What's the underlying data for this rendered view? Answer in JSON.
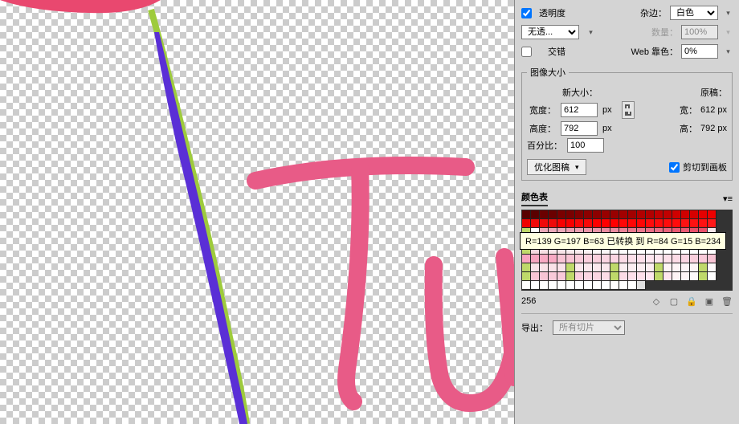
{
  "options": {
    "transparency_label": "透明度",
    "transparency_checked": true,
    "matte_label": "杂边：",
    "matte_value": "白色",
    "no_transparency_value": "无透...",
    "amount_label": "数量：",
    "amount_value": "100%",
    "interlace_label": "交错",
    "interlace_checked": false,
    "web_snap_label": "Web 靠色：",
    "web_snap_value": "0%"
  },
  "image_size": {
    "legend": "图像大小",
    "new_size_label": "新大小：",
    "original_label": "原稿：",
    "width_label": "宽度：",
    "width_value": "612",
    "width_unit": "px",
    "original_width_label": "宽：",
    "original_width_value": "612  px",
    "height_label": "高度：",
    "height_value": "792",
    "height_unit": "px",
    "original_height_label": "高：",
    "original_height_value": "792  px",
    "percent_label": "百分比：",
    "percent_value": "100",
    "optimize_label": "优化图稿",
    "clip_label": "剪切到画板",
    "clip_checked": true
  },
  "color_table": {
    "title": "颜色表",
    "tooltip": "R=139 G=197 B=63  已转换 到  R=84 G=15 B=234",
    "rows": [
      [
        "#5a0000",
        "#5a0000",
        "#6b0000",
        "#6b0000",
        "#7a0000",
        "#7a0000",
        "#820000",
        "#8d0000",
        "#8d0000",
        "#990000",
        "#990000",
        "#a30000",
        "#a30000",
        "#b20000",
        "#b20000",
        "#c10000",
        "#c10000",
        "#cf0000",
        "#cf0000",
        "#d60000",
        "#e60000",
        "#ef0000"
      ],
      [
        "#ef0000",
        "#ef0a0a",
        "#ef0a0a",
        "#ef0a0a",
        "#f80000",
        "#f80000",
        "#f80808",
        "#f80808",
        "#ff0000",
        "#ff0000",
        "#ff0000",
        "#ff0606",
        "#ff0606",
        "#ff0606",
        "#ff0c0c",
        "#ff0c0c",
        "#ff0c0c",
        "#ff0c0c",
        "#ff1212",
        "#ff1212",
        "#ff1212",
        "#ff1818"
      ],
      [
        "#bfd96a",
        "#ffffff",
        "#eaa9b9",
        "#eaa9b9",
        "#eaa9b9",
        "#ea9fb1",
        "#ea9fb1",
        "#ea95a8",
        "#ea95a8",
        "#ea8b9f",
        "#ea8b9f",
        "#ea8196",
        "#ea778d",
        "#ea778d",
        "#ea6d84",
        "#ea6d84",
        "#ea637b",
        "#ea5972",
        "#ea5972",
        "#ea4f69",
        "#ea4f69",
        "#f3e4e8"
      ],
      [
        "#eb5780",
        "#eb5780",
        "#ec5d85",
        "#ec5d85",
        "#ed638a",
        "#ee698f",
        "#ee698f",
        "#ef6f94",
        "#ef6f94",
        "#f07599",
        "#f17b9e",
        "#f17b9e",
        "#f281a3",
        "#f281a3",
        "#f387a8",
        "#f48dad",
        "#f48dad",
        "#f593b2",
        "#f593b2",
        "#f699b7",
        "#f79fbc",
        "#f79fbc"
      ],
      [
        "#bfd96a",
        "#f6d7de",
        "#f7dde2",
        "#f8e3e7",
        "#f8e3e7",
        "#f9e9ec",
        "#f9e9ec",
        "#faeff1",
        "#fbf5f6",
        "#fbf5f6",
        "#fcfbfb",
        "#fcfbfb",
        "#ffffff",
        "#ffffff",
        "#ffffff",
        "#ffffff",
        "#ffffff",
        "#ffffff",
        "#ffffff",
        "#ffffff",
        "#ffffff",
        "#ffffff"
      ],
      [
        "#f7a4bf",
        "#f7a4bf",
        "#f8a9c3",
        "#f8a9c3",
        "#f8c4d4",
        "#f8c4d4",
        "#f9cad9",
        "#facfdd",
        "#facfdd",
        "#fbd5e2",
        "#fbd5e2",
        "#fcdbe6",
        "#fde0ea",
        "#fde0ea",
        "#fee6ef",
        "#fee6ef",
        "#fde0ea",
        "#fcdbe6",
        "#fbd5e2",
        "#facfdd",
        "#f9cad9",
        "#f8c4d4"
      ],
      [
        "#bfd96a",
        "#fae2e8",
        "#fae2e8",
        "#fae2e8",
        "#fae2e8",
        "#bfd96a",
        "#fbe8ed",
        "#fbe8ed",
        "#fbe8ed",
        "#fbe8ed",
        "#bfd96a",
        "#fceef1",
        "#fceef1",
        "#fceef1",
        "#fceef1",
        "#bfd96a",
        "#fdf4f6",
        "#fdf4f6",
        "#fdf4f6",
        "#fdf4f6",
        "#bfd96a",
        "#fefafb"
      ],
      [
        "#bfd96a",
        "#f8c4d4",
        "#f8c4d4",
        "#f9cad9",
        "#f9cad9",
        "#bfd96a",
        "#facfdd",
        "#fbd5e2",
        "#fbd5e2",
        "#fcdbe6",
        "#bfd96a",
        "#fcdbe6",
        "#fde0ea",
        "#fde0ea",
        "#fee6ef",
        "#bfd96a",
        "#fee6ef",
        "#fdf4f6",
        "#fdf4f6",
        "#fefafb",
        "#bfd96a",
        "#ffffff"
      ],
      [
        "#ffffff",
        "#ffffff",
        "#ffffff",
        "#ffffff",
        "#ffffff",
        "#ffffff",
        "#ffffff",
        "#ffffff",
        "#ffffff",
        "#ffffff",
        "#ffffff",
        "#ffffff",
        "#ffffff",
        "#e0e0e0"
      ]
    ],
    "count": "256"
  },
  "export": {
    "label": "导出：",
    "value": "所有切片"
  }
}
